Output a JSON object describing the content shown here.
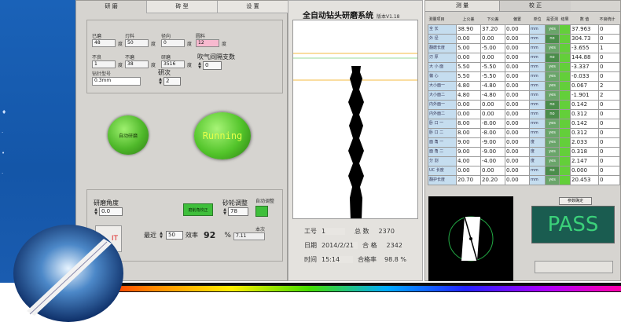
{
  "panel1": {
    "tabs": [
      "研 磨",
      "砖 型",
      "设 置"
    ],
    "params": [
      {
        "label": "已磨",
        "value": "48",
        "unit": "度"
      },
      {
        "label": "刃料",
        "value": "50",
        "unit": "度"
      },
      {
        "label": "径向",
        "value": "0",
        "unit": "度"
      },
      {
        "label": "圆料",
        "value": "12",
        "unit": "度"
      },
      {
        "label": "不良",
        "value": "1",
        "unit": "度"
      },
      {
        "label": "不磨",
        "value": "38",
        "unit": "度"
      },
      {
        "label": "研磨",
        "value": "3516",
        "unit": "度"
      }
    ],
    "blow_label": "吹气间隔支数",
    "blow_value": "0",
    "grind_count_label": "研次",
    "grind_count_value": "2",
    "drill_no_label": "钻针型号",
    "drill_no_value": "0.3mm",
    "left_button": "自动研磨",
    "running_button": "Running",
    "angle_label": "研磨角度",
    "angle_value": "0.0",
    "calib_button": "磨削角校正",
    "wheel_label": "砂轮调整",
    "wheel_value": "78",
    "auto_adjust_label": "自动调整",
    "recent_label": "最近",
    "recent_value": "50",
    "efficiency_label": "效率",
    "efficiency_value": "92",
    "percent_sign": "%",
    "cost_label": "本次",
    "cost_value": "7.11",
    "exit_button": "IT"
  },
  "panel2": {
    "title": "全自动钻头研磨系统",
    "version": "版本V1.18",
    "info": {
      "job_label": "工号",
      "job_value": "1",
      "total_label": "总 数",
      "total_value": "2370",
      "date_label": "日期",
      "date_value": "2014/2/21",
      "ok_label": "合 格",
      "ok_value": "2342",
      "time_label": "时间",
      "time_value": "15:14",
      "rate_label": "合格率",
      "rate_value": "98.8 %"
    }
  },
  "panel3": {
    "tabs": [
      "测 量",
      "校 正"
    ],
    "headers": [
      "测量项目",
      "上公差",
      "下公差",
      "偏置",
      "单位",
      "是否测",
      "结果",
      "数 值",
      "不良统计"
    ],
    "rows": [
      {
        "name": "全 长",
        "upper": "38.90",
        "lower": "37.20",
        "offset": "0.00",
        "unit": "mm",
        "measure": "yes",
        "value": "37.963",
        "bad": "0"
      },
      {
        "name": "外 径",
        "upper": "0.00",
        "lower": "0.00",
        "offset": "0.00",
        "unit": "mm",
        "measure": "no",
        "value": "304.73",
        "bad": "0"
      },
      {
        "name": "翻磨长度",
        "upper": "5.00",
        "lower": "-5.00",
        "offset": "0.00",
        "unit": "mm",
        "measure": "yes",
        "value": "-3.655",
        "bad": "1"
      },
      {
        "name": "刃 厚",
        "upper": "0.00",
        "lower": "0.00",
        "offset": "0.00",
        "unit": "mm",
        "measure": "no",
        "value": "144.88",
        "bad": "0"
      },
      {
        "name": "大 小 面",
        "upper": "5.50",
        "lower": "-5.50",
        "offset": "0.00",
        "unit": "mm",
        "measure": "yes",
        "value": "-3.337",
        "bad": "0"
      },
      {
        "name": "偏 心",
        "upper": "5.50",
        "lower": "-5.50",
        "offset": "0.00",
        "unit": "mm",
        "measure": "yes",
        "value": "-0.033",
        "bad": "0"
      },
      {
        "name": "大小面一",
        "upper": "4.80",
        "lower": "-4.80",
        "offset": "0.00",
        "unit": "mm",
        "measure": "yes",
        "value": "0.067",
        "bad": "2"
      },
      {
        "name": "大小面二",
        "upper": "4.80",
        "lower": "-4.80",
        "offset": "0.00",
        "unit": "mm",
        "measure": "yes",
        "value": "-1.901",
        "bad": "2"
      },
      {
        "name": "内外面一",
        "upper": "0.00",
        "lower": "0.00",
        "offset": "0.00",
        "unit": "mm",
        "measure": "no",
        "value": "0.142",
        "bad": "0"
      },
      {
        "name": "内外面二",
        "upper": "0.00",
        "lower": "0.00",
        "offset": "0.00",
        "unit": "mm",
        "measure": "no",
        "value": "0.312",
        "bad": "0"
      },
      {
        "name": "卧 口 一",
        "upper": "8.00",
        "lower": "-8.00",
        "offset": "0.00",
        "unit": "mm",
        "measure": "yes",
        "value": "0.142",
        "bad": "0"
      },
      {
        "name": "卧 口 二",
        "upper": "8.00",
        "lower": "-8.00",
        "offset": "0.00",
        "unit": "mm",
        "measure": "yes",
        "value": "0.312",
        "bad": "0"
      },
      {
        "name": "面 角 一",
        "upper": "9.00",
        "lower": "-9.00",
        "offset": "0.00",
        "unit": "度",
        "measure": "yes",
        "value": "2.033",
        "bad": "0"
      },
      {
        "name": "面 角 二",
        "upper": "9.00",
        "lower": "-9.00",
        "offset": "0.00",
        "unit": "度",
        "measure": "yes",
        "value": "0.318",
        "bad": "0"
      },
      {
        "name": "分 割",
        "upper": "4.00",
        "lower": "-4.00",
        "offset": "0.00",
        "unit": "度",
        "measure": "yes",
        "value": "2.147",
        "bad": "0"
      },
      {
        "name": "UC 长度",
        "upper": "0.00",
        "lower": "0.00",
        "offset": "0.00",
        "unit": "mm",
        "measure": "no",
        "value": "0.000",
        "bad": "0"
      },
      {
        "name": "翻护长度",
        "upper": "20.70",
        "lower": "20.20",
        "offset": "0.00",
        "unit": "mm",
        "measure": "yes",
        "value": "20.453",
        "bad": "0"
      }
    ],
    "param_button": "参数确定",
    "pass_text": "PASS"
  }
}
